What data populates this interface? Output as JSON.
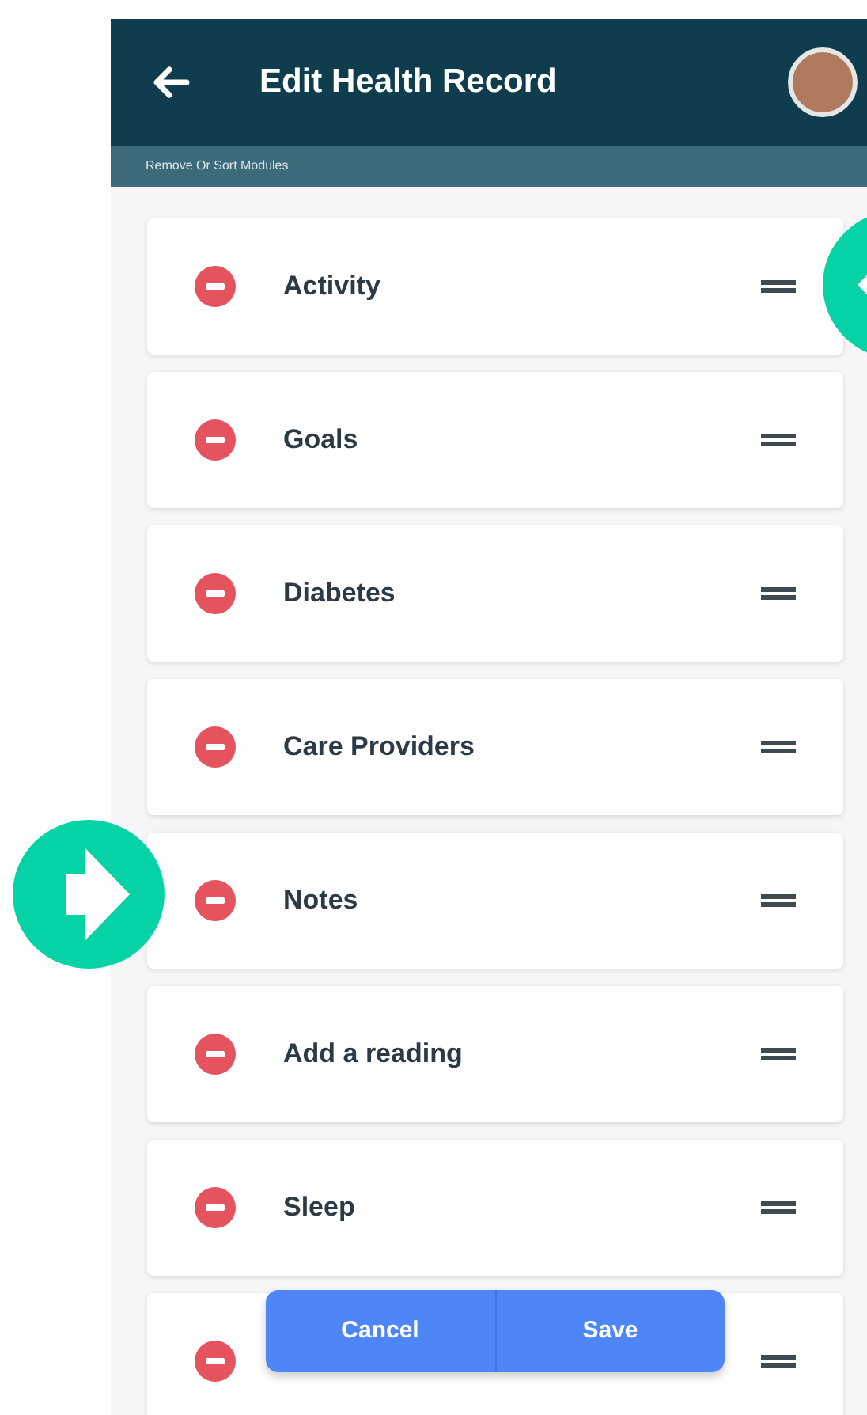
{
  "header": {
    "title": "Edit Health Record"
  },
  "subheader": {
    "text": "Remove Or Sort Modules"
  },
  "modules": [
    {
      "name": "Activity"
    },
    {
      "name": "Goals"
    },
    {
      "name": "Diabetes"
    },
    {
      "name": "Care Providers"
    },
    {
      "name": "Notes"
    },
    {
      "name": "Add a reading"
    },
    {
      "name": "Sleep"
    }
  ],
  "partial_module_visible": true,
  "actions": [
    {
      "label": "Cancel"
    },
    {
      "label": "Save"
    }
  ]
}
